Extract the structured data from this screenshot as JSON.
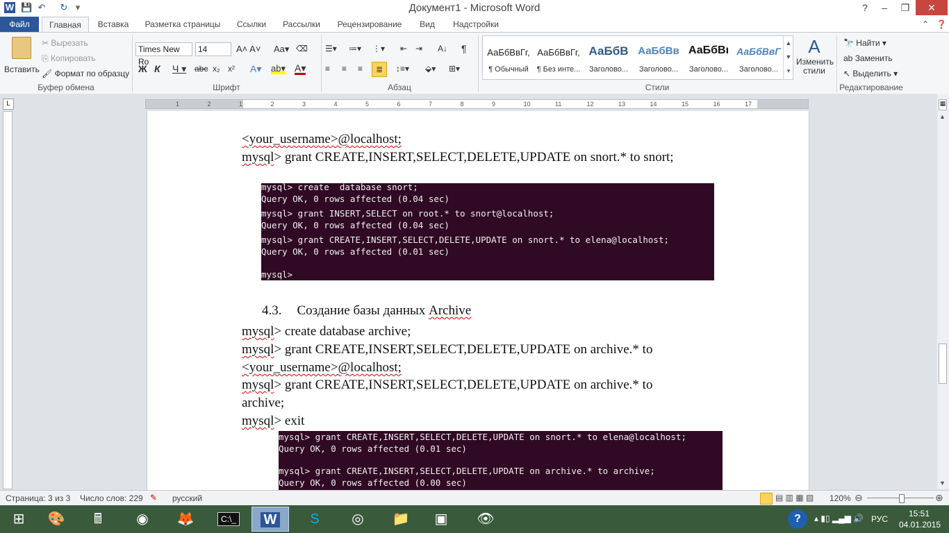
{
  "window": {
    "title": "Документ1  -  Microsoft Word",
    "qat": [
      "W",
      "💾",
      "↶",
      "↻"
    ]
  },
  "tabs": [
    "Файл",
    "Главная",
    "Вставка",
    "Разметка страницы",
    "Ссылки",
    "Рассылки",
    "Рецензирование",
    "Вид",
    "Надстройки"
  ],
  "clipboard": {
    "paste": "Вставить",
    "cut": "Вырезать",
    "copy": "Копировать",
    "painter": "Формат по образцу",
    "label": "Буфер обмена"
  },
  "font": {
    "name": "Times New Ro",
    "size": "14",
    "label": "Шрифт"
  },
  "paragraph": {
    "label": "Абзац"
  },
  "styles": {
    "items": [
      {
        "preview": "АаБбВвГг,",
        "name": "¶ Обычный"
      },
      {
        "preview": "АаБбВвГг,",
        "name": "¶ Без инте..."
      },
      {
        "preview": "АаБбВ",
        "name": "Заголово..."
      },
      {
        "preview": "АаБбВв",
        "name": "Заголово..."
      },
      {
        "preview": "АаБбВı",
        "name": "Заголово..."
      },
      {
        "preview": "АаБбВвГ",
        "name": "Заголово..."
      }
    ],
    "change": "Изменить стили",
    "label": "Стили"
  },
  "editing": {
    "find": "Найти",
    "replace": "Заменить",
    "select": "Выделить",
    "label": "Редактирование"
  },
  "ruler": {
    "marks": [
      "1",
      "2",
      "1",
      "2",
      "3",
      "4",
      "5",
      "6",
      "7",
      "8",
      "9",
      "10",
      "11",
      "12",
      "13",
      "14",
      "15",
      "16",
      "17"
    ]
  },
  "doc": {
    "line1_pre": "<your_username>@localhost;",
    "line2_cmd": "mysql",
    "line2_rest": "> grant CREATE,INSERT,SELECT,DELETE,UPDATE  on snort.* to snort;",
    "heading_num": "4.3.",
    "heading_text": "Создание базы данных ",
    "heading_word": "Archive",
    "l3_cmd": "mysql",
    "l3_rest": "> create database archive;",
    "l4_cmd": "mysql",
    "l4_rest": "> grant CREATE,INSERT,SELECT,DELETE,UPDATE  on archive.* to",
    "l5": "<your_username>@localhost;",
    "l6_cmd": "mysql",
    "l6_rest": "> grant CREATE,INSERT,SELECT,DELETE,UPDATE  on archive.* to",
    "l7": "archive;",
    "l8_cmd": "mysql",
    "l8_rest": "> exit"
  },
  "terminal1": [
    "mysql> create  database snort;",
    "Query OK, 0 rows affected (0.04 sec)",
    "mysql> grant INSERT,SELECT on root.* to snort@localhost;",
    "Query OK, 0 rows affected (0.04 sec)",
    "mysql> grant CREATE,INSERT,SELECT,DELETE,UPDATE on snort.* to elena@localhost;",
    "Query OK, 0 rows affected (0.01 sec)",
    "mysql>"
  ],
  "terminal2": [
    "mysql> grant CREATE,INSERT,SELECT,DELETE,UPDATE on snort.* to elena@localhost;",
    "Query OK, 0 rows affected (0.01 sec)",
    "mysql> grant CREATE,INSERT,SELECT,DELETE,UPDATE on archive.* to archive;",
    "Query OK, 0 rows affected (0.00 sec)"
  ],
  "status": {
    "page": "Страница: 3 из 3",
    "words": "Число слов: 229",
    "lang": "русский",
    "zoom": "120%"
  },
  "taskbar": {
    "lang": "РУС",
    "time": "15:51",
    "date": "04.01.2015"
  }
}
